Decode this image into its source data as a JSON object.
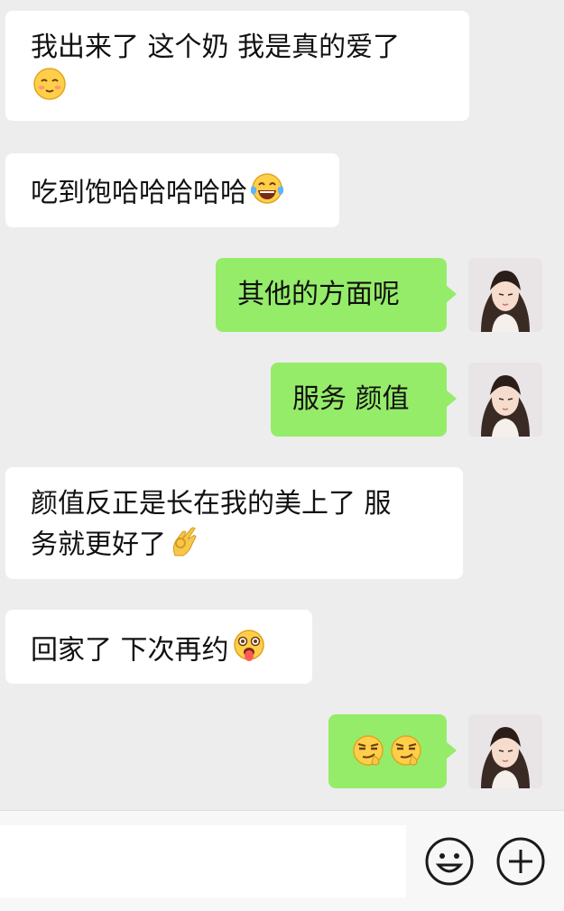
{
  "messages": [
    {
      "side": "in",
      "text_line1": "我出来了 这个奶 我是真的爱了",
      "emoji": "smiling-face-icon"
    },
    {
      "side": "in",
      "text": "吃到饱哈哈哈哈哈",
      "emoji": "tears-of-joy-icon"
    },
    {
      "side": "out",
      "text": "其他的方面呢"
    },
    {
      "side": "out",
      "text": "服务 颜值"
    },
    {
      "side": "in",
      "text_line1": "颜值反正是长在我的美上了 服",
      "text_line2": "务就更好了",
      "emoji": "ok-hand-icon"
    },
    {
      "side": "in",
      "text": "回家了 下次再约",
      "emoji": "tongue-out-icon"
    },
    {
      "side": "out",
      "emoji_only": [
        "smirk-icon",
        "smirk-icon"
      ]
    }
  ],
  "input": {
    "placeholder": ""
  },
  "colors": {
    "background": "#ededed",
    "incoming": "#ffffff",
    "outgoing": "#95ec69",
    "bar": "#f7f7f7"
  }
}
